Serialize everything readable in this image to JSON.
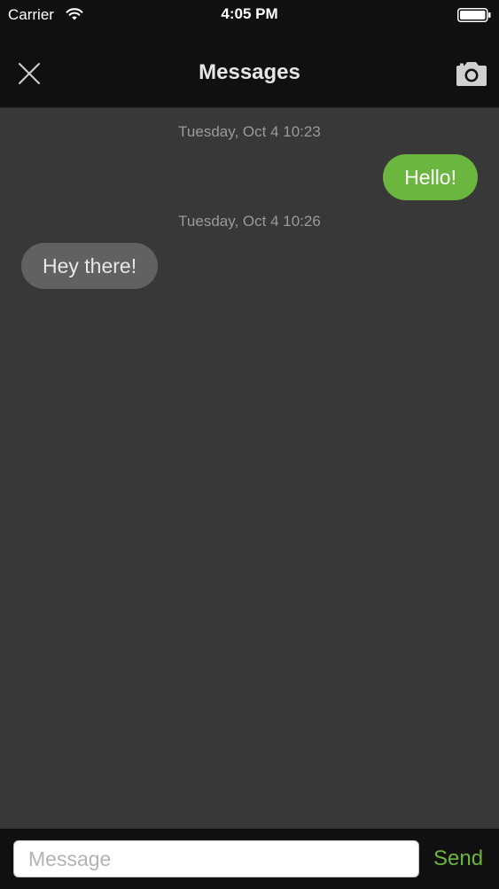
{
  "status_bar": {
    "carrier": "Carrier",
    "time": "4:05 PM"
  },
  "nav": {
    "title": "Messages",
    "left_icon": "close-icon",
    "right_icon": "camera-icon"
  },
  "conversation": {
    "items": [
      {
        "type": "timestamp",
        "text": "Tuesday, Oct 4 10:23"
      },
      {
        "type": "outgoing",
        "text": "Hello!"
      },
      {
        "type": "timestamp",
        "text": "Tuesday, Oct 4 10:26"
      },
      {
        "type": "incoming",
        "text": "Hey there!"
      }
    ]
  },
  "composer": {
    "placeholder": "Message",
    "value": "",
    "send_label": "Send"
  },
  "colors": {
    "accent": "#6ab63e",
    "background": "#383838",
    "bar": "#101010",
    "incoming_bubble": "#616161"
  }
}
